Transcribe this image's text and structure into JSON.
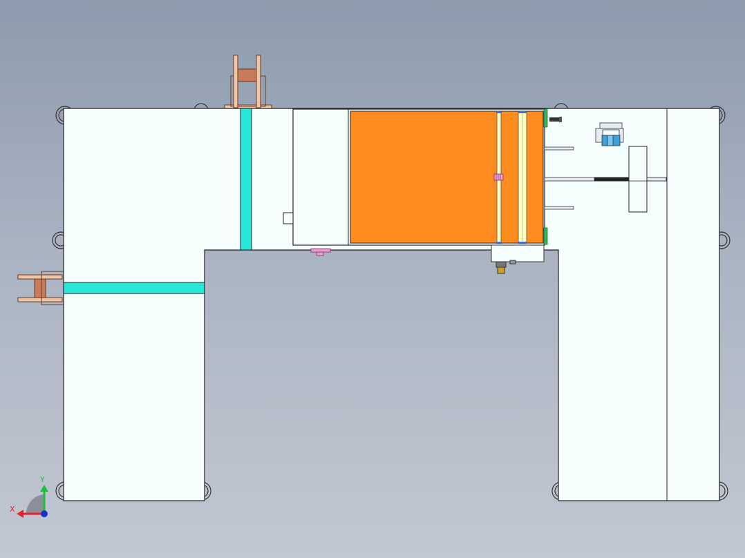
{
  "viewport": {
    "background_top": "#8d9bae",
    "background_bottom": "#c2c8d2"
  },
  "colors": {
    "frame_fill": "#f4fffe",
    "frame_stroke": "#222222",
    "cyan_band": "#28e6d8",
    "orange_panel": "#ff8c1e",
    "roller_yellow": "#fffcc0",
    "reel_copper": "#c97a58",
    "reel_copper_light": "#f0c6a8",
    "connector_green": "#2fb85a",
    "block_blue": "#3aa0e0",
    "part_pink": "#d070a0"
  },
  "triad": {
    "x_label": "X",
    "y_label": "Y",
    "x_color": "#e8202a",
    "y_color": "#18c23a",
    "z_color": "#1a2fd0"
  }
}
